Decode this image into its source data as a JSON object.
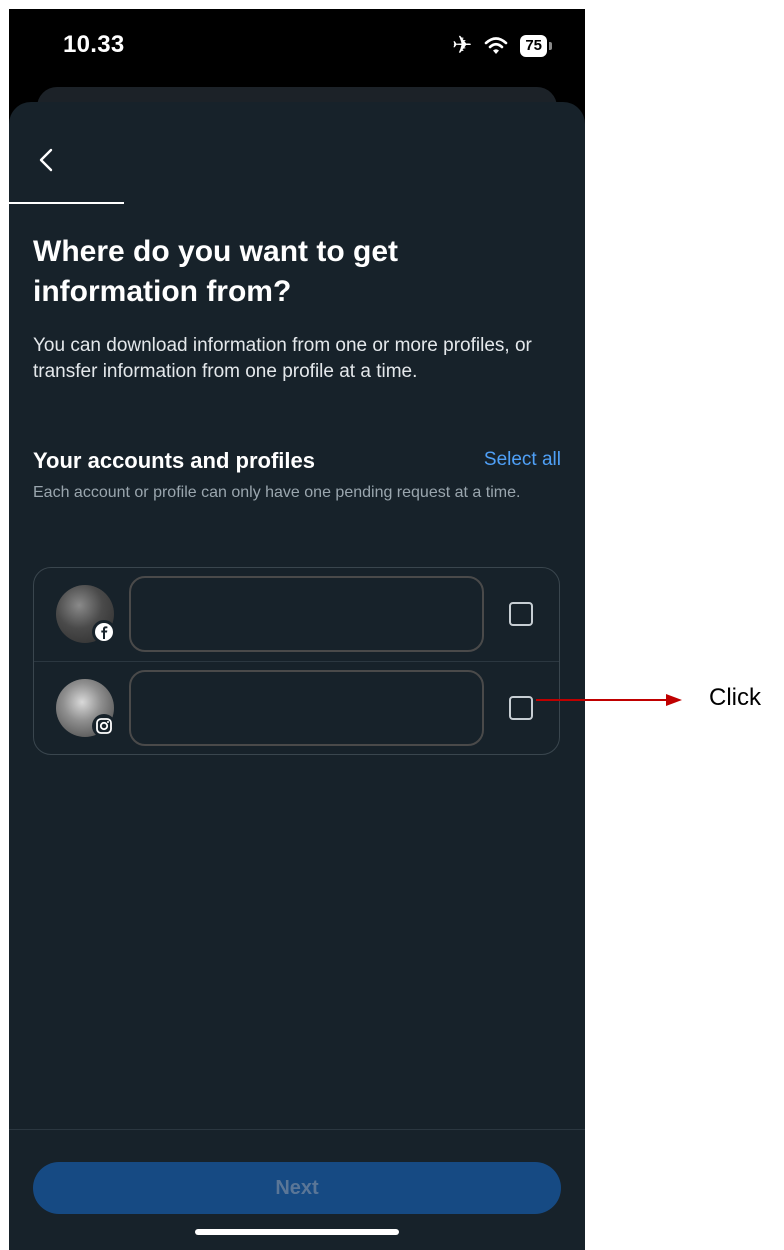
{
  "status_bar": {
    "time": "10.33",
    "battery": "75"
  },
  "screen": {
    "title": "Where do you want to get information from?",
    "description": "You can download information from one or more profiles, or transfer information from one profile at a time.",
    "section_title": "Your accounts and profiles",
    "select_all": "Select all",
    "section_note": "Each account or profile can only have one pending request at a time."
  },
  "accounts": [
    {
      "platform": "facebook",
      "badge_icon": "facebook-icon",
      "checked": false
    },
    {
      "platform": "instagram",
      "badge_icon": "instagram-icon",
      "checked": false
    }
  ],
  "footer": {
    "next_label": "Next"
  },
  "annotation": {
    "label": "Click",
    "color": "#c00000"
  }
}
